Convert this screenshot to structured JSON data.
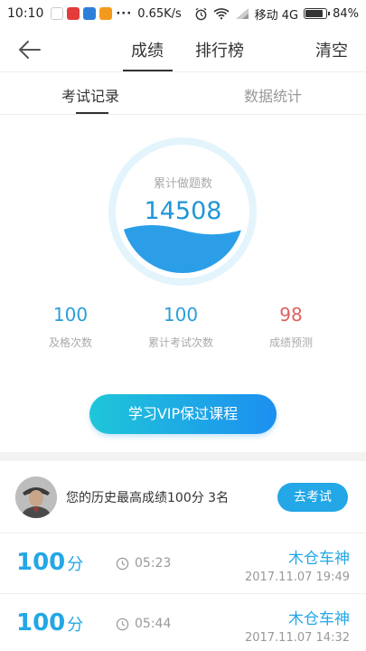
{
  "status_bar": {
    "time": "10:10",
    "speed": "0.65K/s",
    "carrier": "移动 4G",
    "battery": "84%"
  },
  "nav": {
    "tabs": [
      "成绩",
      "排行榜"
    ],
    "clear_label": "清空"
  },
  "sub_tabs": [
    "考试记录",
    "数据统计"
  ],
  "summary": {
    "label": "累计做题数",
    "value": "14508",
    "fill_level": 0.35
  },
  "stats": [
    {
      "value": "100",
      "label": "及格次数",
      "color": "#2a9fd8"
    },
    {
      "value": "100",
      "label": "累计考试次数",
      "color": "#2a9fd8"
    },
    {
      "value": "98",
      "label": "成绩预测",
      "color": "#e06060"
    }
  ],
  "vip_button": "学习VIP保过课程",
  "best": {
    "text": "您的历史最高成绩100分  3名",
    "button": "去考试"
  },
  "records": [
    {
      "score": "100",
      "unit": "分",
      "duration": "05:23",
      "name": "木仓车神",
      "date": "2017.11.07   19:49"
    },
    {
      "score": "100",
      "unit": "分",
      "duration": "05:44",
      "name": "木仓车神",
      "date": "2017.11.07   14:32"
    }
  ]
}
